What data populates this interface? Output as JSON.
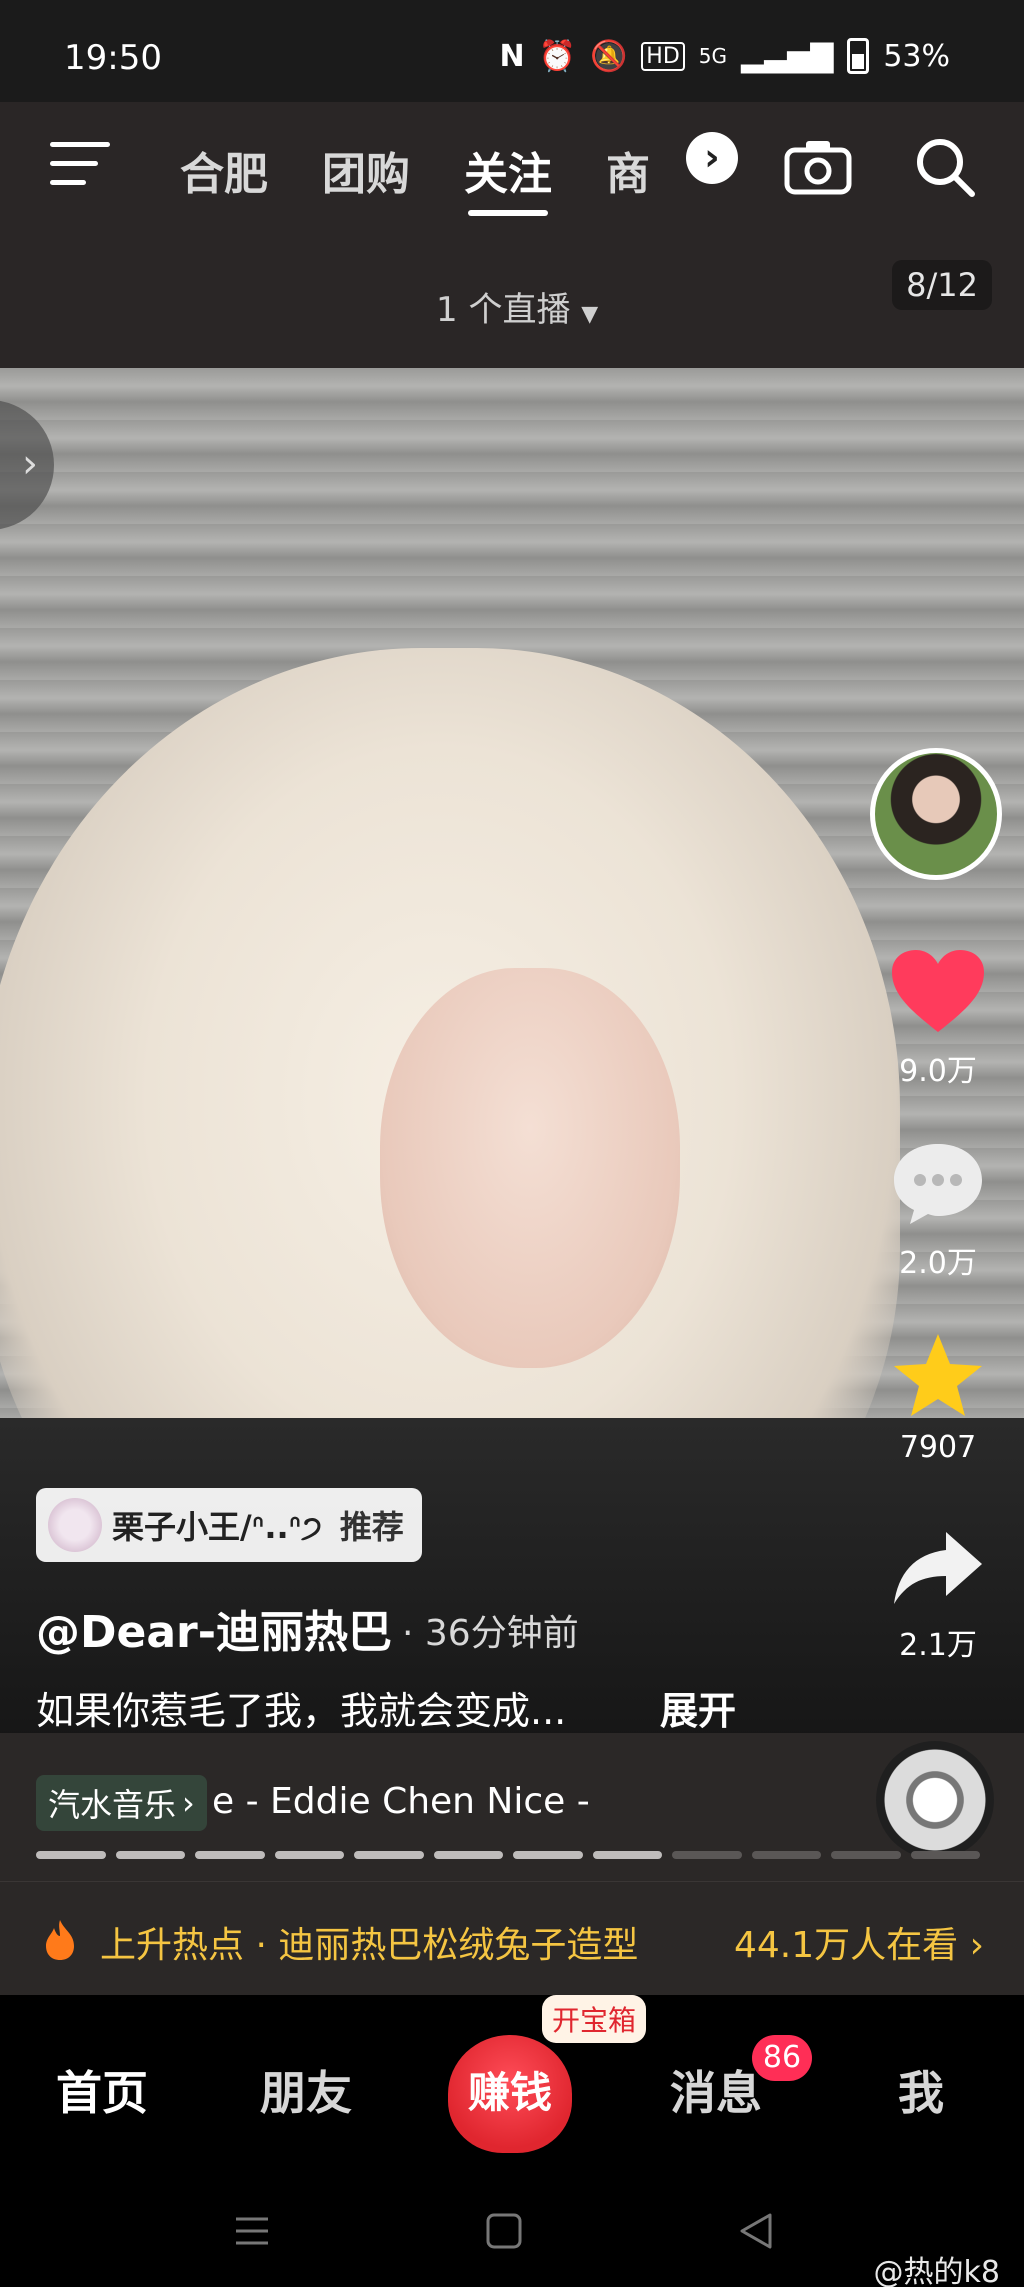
{
  "status_bar": {
    "time": "19:50",
    "network": "5G",
    "battery": "53%"
  },
  "top_nav": {
    "tabs": [
      "合肥",
      "团购",
      "关注",
      "商"
    ],
    "active_tab": "关注"
  },
  "sub_nav": {
    "live_label": "1 个直播",
    "page_counter": "8/12"
  },
  "actions": {
    "likes": "9.0万",
    "comments": "2.0万",
    "favorites": "7907",
    "shares": "2.1万"
  },
  "post": {
    "recommend_name": "栗子小王/ᐢ..ᐢ੭",
    "recommend_label": "推荐",
    "username": "@Dear-迪丽热巴",
    "time": "· 36分钟前",
    "description": "如果你惹毛了我，我就会变成...",
    "expand": "展开"
  },
  "music": {
    "app": "汽水音乐",
    "track": "e - Eddie Chen     Nice - ",
    "progress_fraction": 0.667
  },
  "hot": {
    "text": "上升热点 · 迪丽热巴松绒兔子造型",
    "watching": "44.1万人在看"
  },
  "bottom_nav": {
    "home": "首页",
    "friends": "朋友",
    "earn": "赚钱",
    "earn_badge": "开宝箱",
    "messages": "消息",
    "messages_badge": "86",
    "me": "我"
  },
  "watermark": "@热的k8",
  "colors": {
    "accent_red": "#e0262f",
    "hot_yellow": "#f5c542",
    "like_pink": "#ff3b5c",
    "star_yellow": "#ffcc1a"
  }
}
